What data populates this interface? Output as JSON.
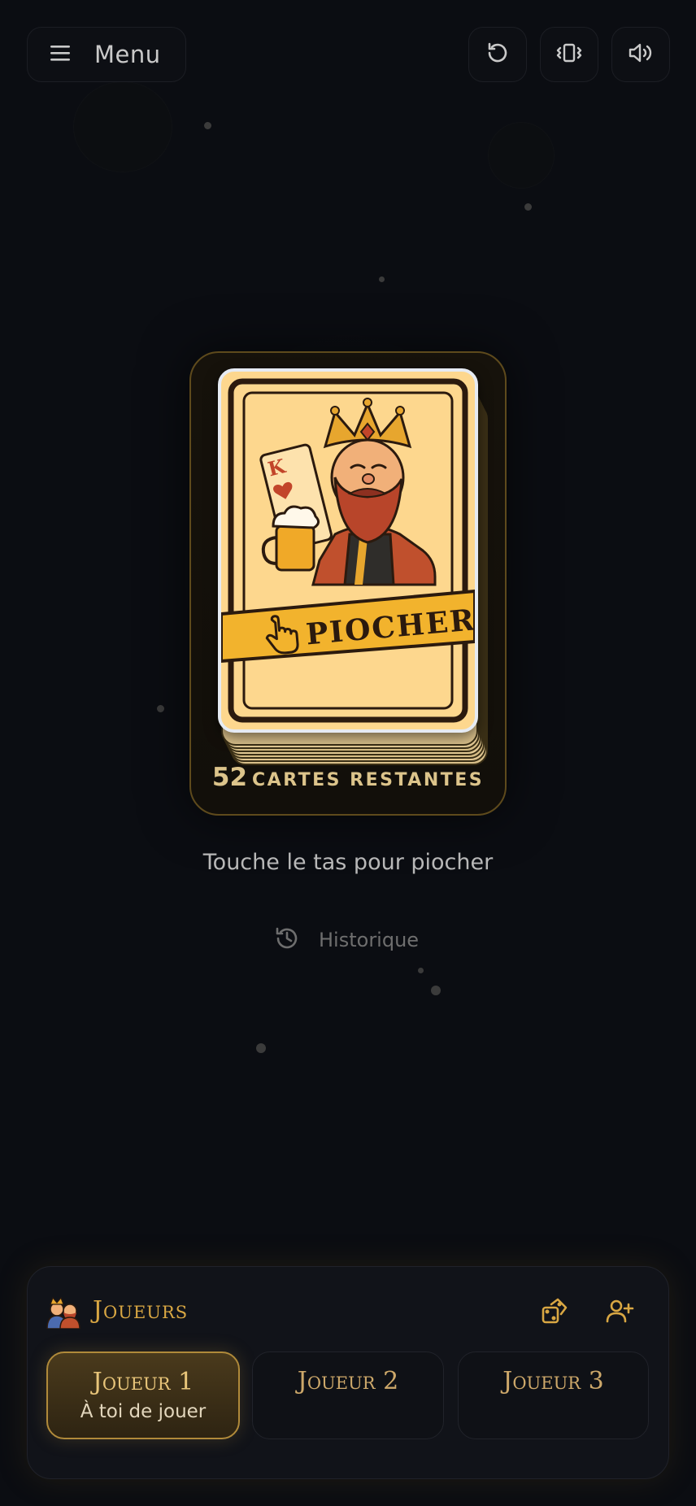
{
  "topbar": {
    "menu_label": "Menu",
    "menu_icon": "hamburger-icon",
    "reset_icon": "reset-icon",
    "vibrate_icon": "vibrate-icon",
    "sound_icon": "speaker-icon"
  },
  "deck": {
    "card_label": "PIOCHER",
    "card_rank": "K",
    "cards_remaining_count": "52",
    "cards_remaining_label": "CARTES RESTANTES",
    "hint": "Touche le tas pour piocher"
  },
  "history": {
    "label": "Historique",
    "icon": "history-icon"
  },
  "players": {
    "title": "Joueurs",
    "title_icon": "players-emoji-icon",
    "dice_icon": "dice-icon",
    "add_icon": "add-user-icon",
    "list": [
      {
        "name": "Joueur 1",
        "status": "À toi de jouer",
        "active": true
      },
      {
        "name": "Joueur 2",
        "status": "",
        "active": false
      },
      {
        "name": "Joueur 3",
        "status": "",
        "active": false
      }
    ]
  },
  "colors": {
    "background": "#0b0d12",
    "accent_gold": "#d9a743",
    "card_cream": "#fdd78e",
    "ribbon_yellow": "#f2b32d"
  }
}
